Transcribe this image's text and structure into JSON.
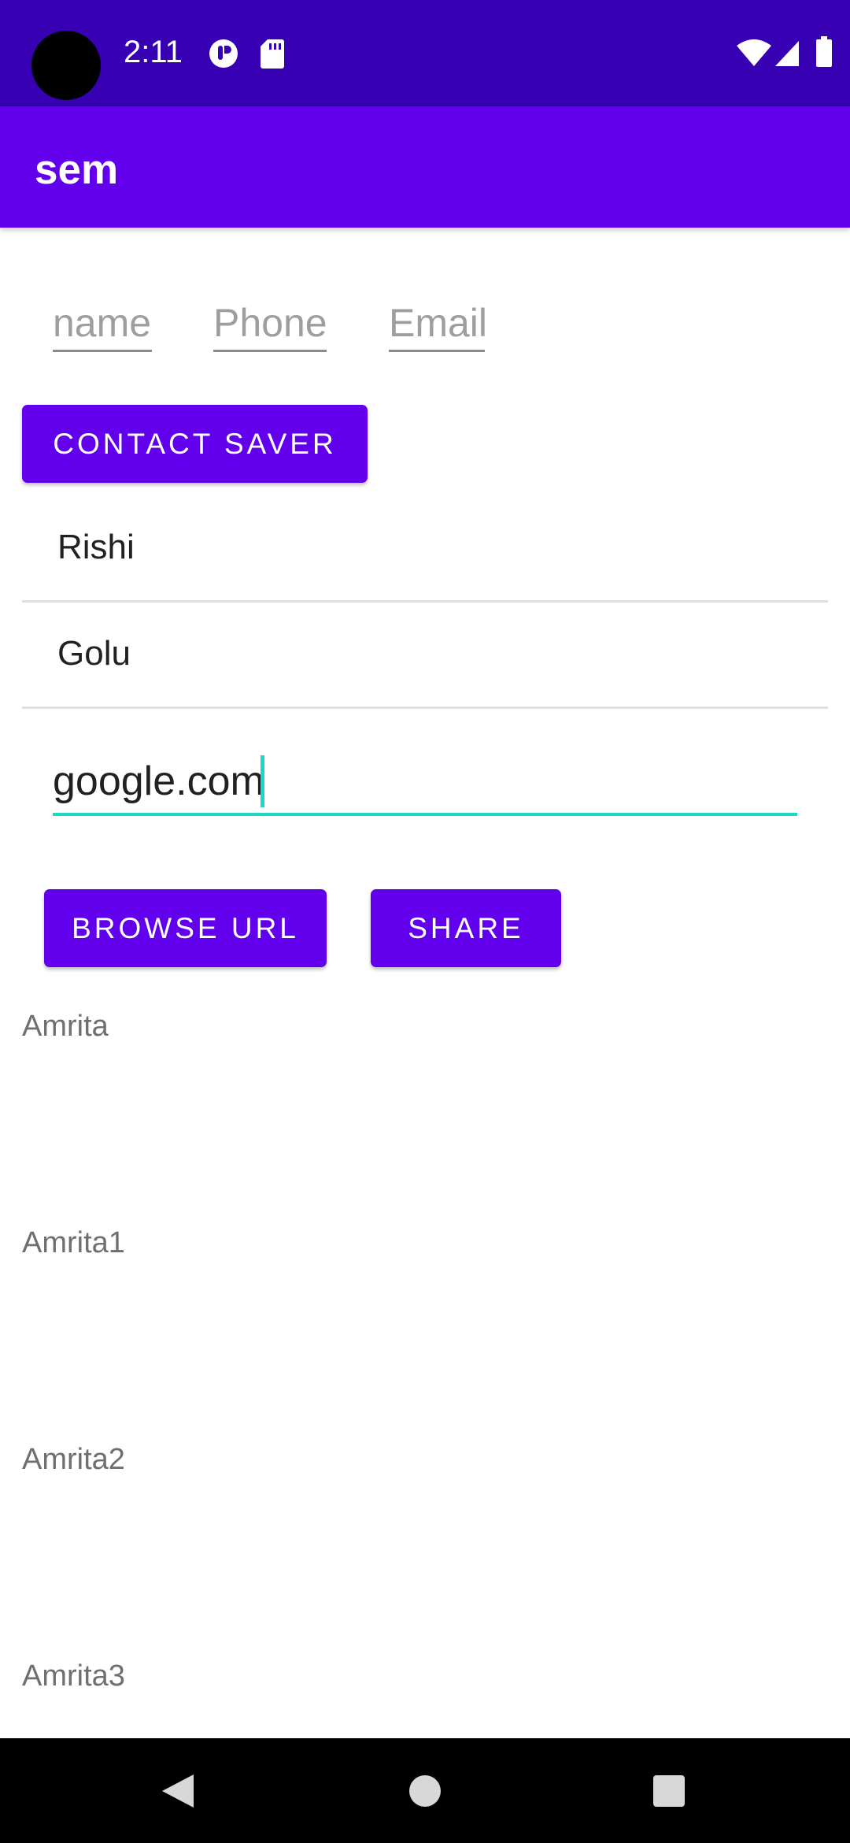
{
  "status_bar": {
    "time": "2:11",
    "icons": [
      "notification-icon",
      "sd-card-icon",
      "wifi-icon",
      "signal-icon",
      "battery-icon"
    ]
  },
  "app_bar": {
    "title": "sem"
  },
  "form": {
    "name_placeholder": "name",
    "phone_placeholder": "Phone",
    "email_placeholder": "Email",
    "contact_saver_label": "CONTACT SAVER"
  },
  "contacts": [
    "Rishi",
    "Golu"
  ],
  "url_input": {
    "value": "google.com"
  },
  "actions": {
    "browse_label": "BROWSE URL",
    "share_label": "SHARE"
  },
  "items": [
    "Amrita",
    "Amrita1",
    "Amrita2",
    "Amrita3"
  ],
  "colors": {
    "status_bar": "#3700b3",
    "primary": "#6200ee",
    "accent": "#1dd6c6"
  },
  "nav_bar": {
    "icons": [
      "back-icon",
      "home-icon",
      "recents-icon"
    ]
  }
}
